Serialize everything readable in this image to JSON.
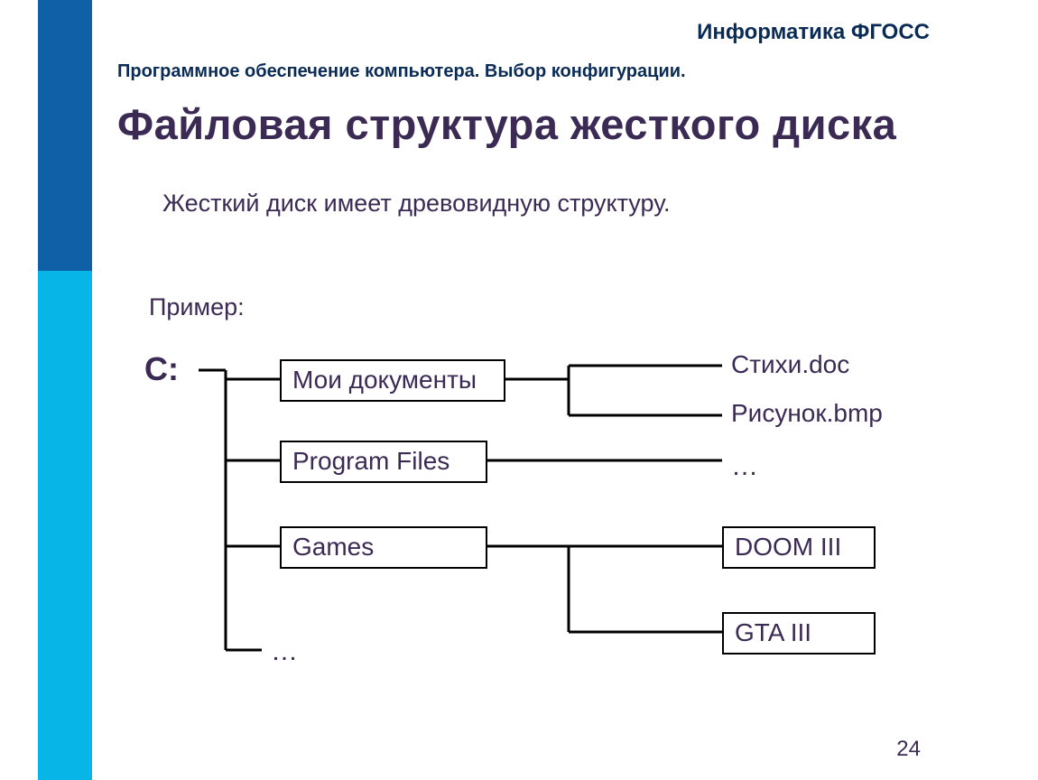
{
  "header": {
    "course_tag": "Информатика ФГОСС",
    "breadcrumb": "Программное обеспечение компьютера. Выбор конфигурации.",
    "page_title": "Файловая структура жесткого диска"
  },
  "body": {
    "intro_text": "Жесткий диск имеет древовидную структуру.",
    "example_label": "Пример:"
  },
  "tree": {
    "root": "C:",
    "level1": {
      "my_documents": "Мои документы",
      "program_files": "Program Files",
      "games": "Games",
      "more": "…"
    },
    "my_documents_children": {
      "file1": "Стихи.doc",
      "file2": "Рисунок.bmp"
    },
    "program_files_children": {
      "more": "…"
    },
    "games_children": {
      "doom": "DOOM III",
      "gta": "GTA III"
    }
  },
  "page_number": "24"
}
